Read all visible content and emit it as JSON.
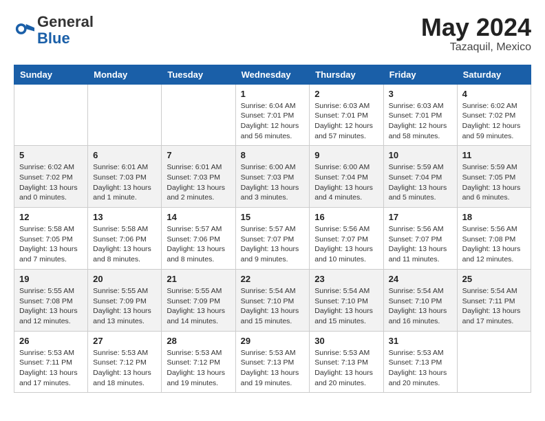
{
  "header": {
    "logo_general": "General",
    "logo_blue": "Blue",
    "month_year": "May 2024",
    "location": "Tazaquil, Mexico"
  },
  "days_of_week": [
    "Sunday",
    "Monday",
    "Tuesday",
    "Wednesday",
    "Thursday",
    "Friday",
    "Saturday"
  ],
  "weeks": [
    [
      {
        "day": "",
        "info": ""
      },
      {
        "day": "",
        "info": ""
      },
      {
        "day": "",
        "info": ""
      },
      {
        "day": "1",
        "info": "Sunrise: 6:04 AM\nSunset: 7:01 PM\nDaylight: 12 hours and 56 minutes."
      },
      {
        "day": "2",
        "info": "Sunrise: 6:03 AM\nSunset: 7:01 PM\nDaylight: 12 hours and 57 minutes."
      },
      {
        "day": "3",
        "info": "Sunrise: 6:03 AM\nSunset: 7:01 PM\nDaylight: 12 hours and 58 minutes."
      },
      {
        "day": "4",
        "info": "Sunrise: 6:02 AM\nSunset: 7:02 PM\nDaylight: 12 hours and 59 minutes."
      }
    ],
    [
      {
        "day": "5",
        "info": "Sunrise: 6:02 AM\nSunset: 7:02 PM\nDaylight: 13 hours and 0 minutes."
      },
      {
        "day": "6",
        "info": "Sunrise: 6:01 AM\nSunset: 7:03 PM\nDaylight: 13 hours and 1 minute."
      },
      {
        "day": "7",
        "info": "Sunrise: 6:01 AM\nSunset: 7:03 PM\nDaylight: 13 hours and 2 minutes."
      },
      {
        "day": "8",
        "info": "Sunrise: 6:00 AM\nSunset: 7:03 PM\nDaylight: 13 hours and 3 minutes."
      },
      {
        "day": "9",
        "info": "Sunrise: 6:00 AM\nSunset: 7:04 PM\nDaylight: 13 hours and 4 minutes."
      },
      {
        "day": "10",
        "info": "Sunrise: 5:59 AM\nSunset: 7:04 PM\nDaylight: 13 hours and 5 minutes."
      },
      {
        "day": "11",
        "info": "Sunrise: 5:59 AM\nSunset: 7:05 PM\nDaylight: 13 hours and 6 minutes."
      }
    ],
    [
      {
        "day": "12",
        "info": "Sunrise: 5:58 AM\nSunset: 7:05 PM\nDaylight: 13 hours and 7 minutes."
      },
      {
        "day": "13",
        "info": "Sunrise: 5:58 AM\nSunset: 7:06 PM\nDaylight: 13 hours and 8 minutes."
      },
      {
        "day": "14",
        "info": "Sunrise: 5:57 AM\nSunset: 7:06 PM\nDaylight: 13 hours and 8 minutes."
      },
      {
        "day": "15",
        "info": "Sunrise: 5:57 AM\nSunset: 7:07 PM\nDaylight: 13 hours and 9 minutes."
      },
      {
        "day": "16",
        "info": "Sunrise: 5:56 AM\nSunset: 7:07 PM\nDaylight: 13 hours and 10 minutes."
      },
      {
        "day": "17",
        "info": "Sunrise: 5:56 AM\nSunset: 7:07 PM\nDaylight: 13 hours and 11 minutes."
      },
      {
        "day": "18",
        "info": "Sunrise: 5:56 AM\nSunset: 7:08 PM\nDaylight: 13 hours and 12 minutes."
      }
    ],
    [
      {
        "day": "19",
        "info": "Sunrise: 5:55 AM\nSunset: 7:08 PM\nDaylight: 13 hours and 12 minutes."
      },
      {
        "day": "20",
        "info": "Sunrise: 5:55 AM\nSunset: 7:09 PM\nDaylight: 13 hours and 13 minutes."
      },
      {
        "day": "21",
        "info": "Sunrise: 5:55 AM\nSunset: 7:09 PM\nDaylight: 13 hours and 14 minutes."
      },
      {
        "day": "22",
        "info": "Sunrise: 5:54 AM\nSunset: 7:10 PM\nDaylight: 13 hours and 15 minutes."
      },
      {
        "day": "23",
        "info": "Sunrise: 5:54 AM\nSunset: 7:10 PM\nDaylight: 13 hours and 15 minutes."
      },
      {
        "day": "24",
        "info": "Sunrise: 5:54 AM\nSunset: 7:10 PM\nDaylight: 13 hours and 16 minutes."
      },
      {
        "day": "25",
        "info": "Sunrise: 5:54 AM\nSunset: 7:11 PM\nDaylight: 13 hours and 17 minutes."
      }
    ],
    [
      {
        "day": "26",
        "info": "Sunrise: 5:53 AM\nSunset: 7:11 PM\nDaylight: 13 hours and 17 minutes."
      },
      {
        "day": "27",
        "info": "Sunrise: 5:53 AM\nSunset: 7:12 PM\nDaylight: 13 hours and 18 minutes."
      },
      {
        "day": "28",
        "info": "Sunrise: 5:53 AM\nSunset: 7:12 PM\nDaylight: 13 hours and 19 minutes."
      },
      {
        "day": "29",
        "info": "Sunrise: 5:53 AM\nSunset: 7:13 PM\nDaylight: 13 hours and 19 minutes."
      },
      {
        "day": "30",
        "info": "Sunrise: 5:53 AM\nSunset: 7:13 PM\nDaylight: 13 hours and 20 minutes."
      },
      {
        "day": "31",
        "info": "Sunrise: 5:53 AM\nSunset: 7:13 PM\nDaylight: 13 hours and 20 minutes."
      },
      {
        "day": "",
        "info": ""
      }
    ]
  ]
}
